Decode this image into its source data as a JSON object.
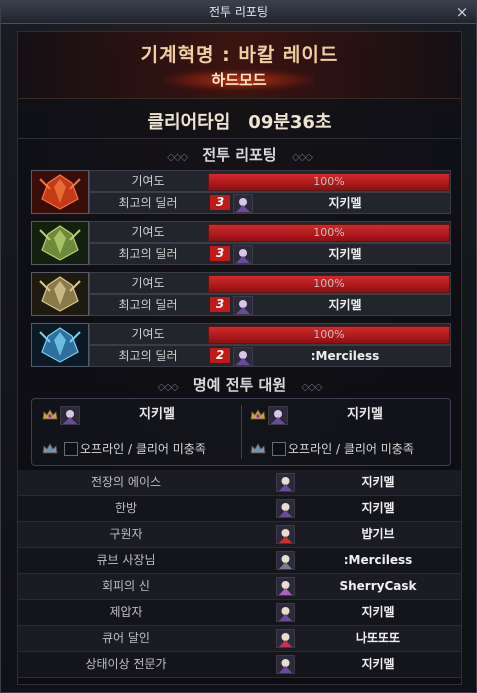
{
  "window": {
    "title": "전투 리포팅",
    "close_glyph": "×"
  },
  "raid": {
    "name": "기계혁명 : 바칼 레이드",
    "mode": "하드모드"
  },
  "clear": {
    "label": "클리어타임",
    "time": "09분36초"
  },
  "sections": {
    "report": "전투 리포팅",
    "honor": "명예 전투 대원",
    "deco_left": "◇◇◇",
    "deco_right": "◇◇◇"
  },
  "parties": [
    {
      "portrait": "red-dragon-icon",
      "contribution_label": "기여도",
      "contribution": 100,
      "contribution_text": "100%",
      "dealer_label": "최고의 딜러",
      "dealer_count": "3",
      "dealer": "지키멜"
    },
    {
      "portrait": "green-dragon-icon",
      "contribution_label": "기여도",
      "contribution": 100,
      "contribution_text": "100%",
      "dealer_label": "최고의 딜러",
      "dealer_count": "3",
      "dealer": "지키멜"
    },
    {
      "portrait": "gold-dragon-icon",
      "contribution_label": "기여도",
      "contribution": 100,
      "contribution_text": "100%",
      "dealer_label": "최고의 딜러",
      "dealer_count": "3",
      "dealer": "지키멜"
    },
    {
      "portrait": "blue-dragon-icon",
      "contribution_label": "기여도",
      "contribution": 100,
      "contribution_text": "100%",
      "dealer_label": "최고의 딜러",
      "dealer_count": "2",
      "dealer": ":Merciless"
    }
  ],
  "honor": {
    "members": [
      "지키멜",
      "지키멜"
    ],
    "offline_label": "오프라인 / 클리어 미충족"
  },
  "awards": [
    {
      "title": "전장의 에이스",
      "player": "지키멜"
    },
    {
      "title": "한방",
      "player": "지키멜"
    },
    {
      "title": "구원자",
      "player": "뱝기브"
    },
    {
      "title": "큐브 사장님",
      "player": ":Merciless"
    },
    {
      "title": "회피의 신",
      "player": "SherryCask"
    },
    {
      "title": "제압자",
      "player": "지키멜"
    },
    {
      "title": "큐어 달인",
      "player": "나또또또"
    },
    {
      "title": "상태이상 전문가",
      "player": "지키멜"
    }
  ],
  "colors": {
    "bar_red": "#c81e1e",
    "accent_gold": "#f0cfa0",
    "count_badge": "#c31818"
  }
}
